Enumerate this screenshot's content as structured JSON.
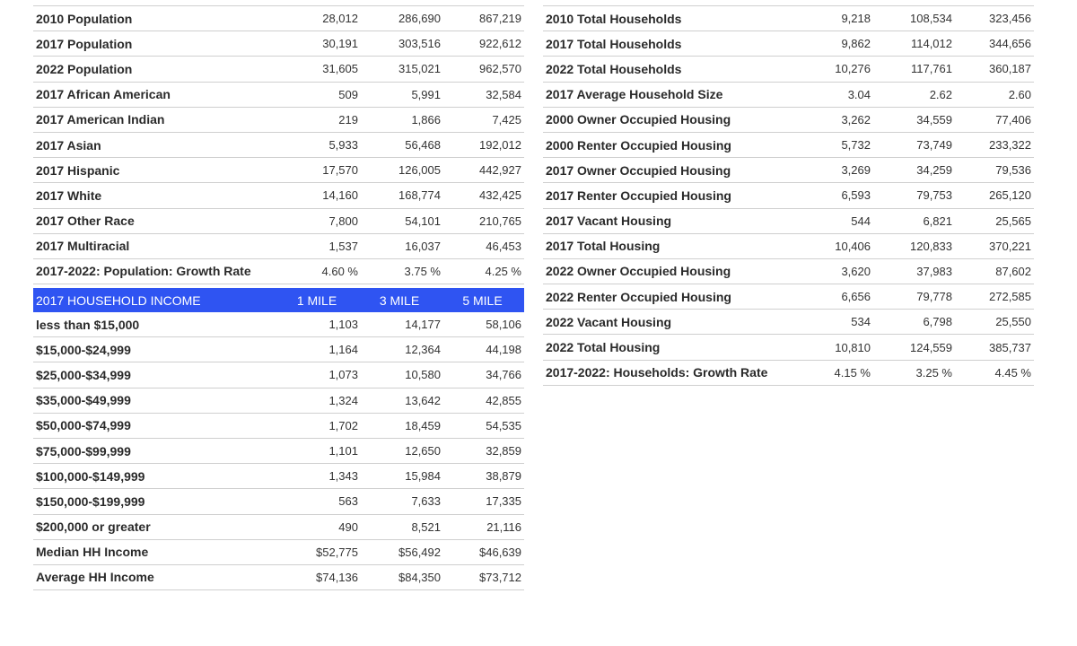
{
  "population": {
    "rows": [
      {
        "label": "2010 Population",
        "v1": "28,012",
        "v3": "286,690",
        "v5": "867,219"
      },
      {
        "label": "2017 Population",
        "v1": "30,191",
        "v3": "303,516",
        "v5": "922,612"
      },
      {
        "label": "2022 Population",
        "v1": "31,605",
        "v3": "315,021",
        "v5": "962,570"
      },
      {
        "label": "2017 African American",
        "v1": "509",
        "v3": "5,991",
        "v5": "32,584"
      },
      {
        "label": "2017 American Indian",
        "v1": "219",
        "v3": "1,866",
        "v5": "7,425"
      },
      {
        "label": "2017 Asian",
        "v1": "5,933",
        "v3": "56,468",
        "v5": "192,012"
      },
      {
        "label": "2017 Hispanic",
        "v1": "17,570",
        "v3": "126,005",
        "v5": "442,927"
      },
      {
        "label": "2017 White",
        "v1": "14,160",
        "v3": "168,774",
        "v5": "432,425"
      },
      {
        "label": "2017 Other Race",
        "v1": "7,800",
        "v3": "54,101",
        "v5": "210,765"
      },
      {
        "label": "2017 Multiracial",
        "v1": "1,537",
        "v3": "16,037",
        "v5": "46,453"
      },
      {
        "label": "2017-2022: Population: Growth Rate",
        "v1": "4.60 %",
        "v3": "3.75 %",
        "v5": "4.25 %"
      }
    ]
  },
  "income": {
    "header": {
      "title": "2017 HOUSEHOLD INCOME",
      "c1": "1 MILE",
      "c3": "3 MILE",
      "c5": "5 MILE"
    },
    "accent_color": "#2f54f2",
    "rows": [
      {
        "label": "less than $15,000",
        "v1": "1,103",
        "v3": "14,177",
        "v5": "58,106"
      },
      {
        "label": "$15,000-$24,999",
        "v1": "1,164",
        "v3": "12,364",
        "v5": "44,198"
      },
      {
        "label": "$25,000-$34,999",
        "v1": "1,073",
        "v3": "10,580",
        "v5": "34,766"
      },
      {
        "label": "$35,000-$49,999",
        "v1": "1,324",
        "v3": "13,642",
        "v5": "42,855"
      },
      {
        "label": "$50,000-$74,999",
        "v1": "1,702",
        "v3": "18,459",
        "v5": "54,535"
      },
      {
        "label": "$75,000-$99,999",
        "v1": "1,101",
        "v3": "12,650",
        "v5": "32,859"
      },
      {
        "label": "$100,000-$149,999",
        "v1": "1,343",
        "v3": "15,984",
        "v5": "38,879"
      },
      {
        "label": "$150,000-$199,999",
        "v1": "563",
        "v3": "7,633",
        "v5": "17,335"
      },
      {
        "label": "$200,000 or greater",
        "v1": "490",
        "v3": "8,521",
        "v5": "21,116"
      },
      {
        "label": "Median HH Income",
        "v1": "$52,775",
        "v3": "$56,492",
        "v5": "$46,639"
      },
      {
        "label": "Average HH Income",
        "v1": "$74,136",
        "v3": "$84,350",
        "v5": "$73,712"
      }
    ]
  },
  "households": {
    "rows": [
      {
        "label": "2010 Total Households",
        "v1": "9,218",
        "v3": "108,534",
        "v5": "323,456"
      },
      {
        "label": "2017 Total Households",
        "v1": "9,862",
        "v3": "114,012",
        "v5": "344,656"
      },
      {
        "label": "2022 Total Households",
        "v1": "10,276",
        "v3": "117,761",
        "v5": "360,187"
      },
      {
        "label": "2017 Average Household Size",
        "v1": "3.04",
        "v3": "2.62",
        "v5": "2.60"
      },
      {
        "label": "2000 Owner Occupied Housing",
        "v1": "3,262",
        "v3": "34,559",
        "v5": "77,406"
      },
      {
        "label": "2000 Renter Occupied Housing",
        "v1": "5,732",
        "v3": "73,749",
        "v5": "233,322"
      },
      {
        "label": "2017 Owner Occupied Housing",
        "v1": "3,269",
        "v3": "34,259",
        "v5": "79,536"
      },
      {
        "label": "2017 Renter Occupied Housing",
        "v1": "6,593",
        "v3": "79,753",
        "v5": "265,120"
      },
      {
        "label": "2017 Vacant Housing",
        "v1": "544",
        "v3": "6,821",
        "v5": "25,565"
      },
      {
        "label": "2017 Total Housing",
        "v1": "10,406",
        "v3": "120,833",
        "v5": "370,221"
      },
      {
        "label": "2022 Owner Occupied Housing",
        "v1": "3,620",
        "v3": "37,983",
        "v5": "87,602"
      },
      {
        "label": "2022 Renter Occupied Housing",
        "v1": "6,656",
        "v3": "79,778",
        "v5": "272,585"
      },
      {
        "label": "2022 Vacant Housing",
        "v1": "534",
        "v3": "6,798",
        "v5": "25,550"
      },
      {
        "label": "2022 Total Housing",
        "v1": "10,810",
        "v3": "124,559",
        "v5": "385,737"
      },
      {
        "label": "2017-2022: Households: Growth Rate",
        "v1": "4.15 %",
        "v3": "3.25 %",
        "v5": "4.45 %"
      }
    ]
  }
}
